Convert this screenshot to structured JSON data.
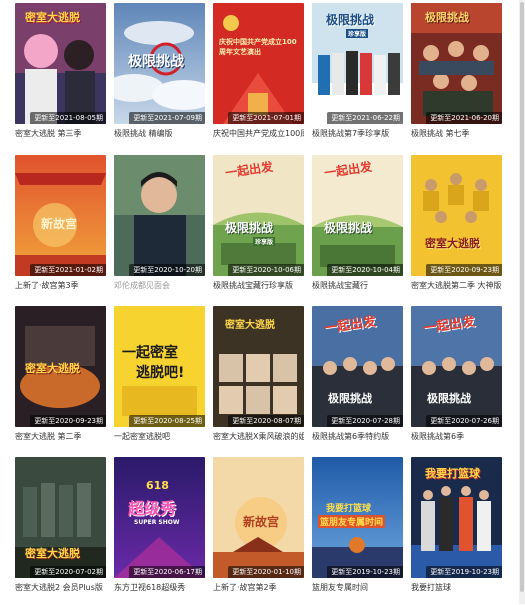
{
  "cards": [
    {
      "title": "密室大逃脱 第三季",
      "badge": "更新至2021-08-05期",
      "logo": "密室大逃脱"
    },
    {
      "title": "极限挑战 精编版",
      "badge": "更新至2021-07-09期",
      "logo": "极限挑战"
    },
    {
      "title": "庆祝中国共产党成立100周",
      "badge": "更新至2021-07-01期",
      "poster_text": "庆祝中国共产党成立100周年文艺演出"
    },
    {
      "title": "极限挑战第7季珍享版",
      "badge": "更新至2021-06-22期",
      "logo": "极限挑战",
      "sub": "珍享版"
    },
    {
      "title": "极限挑战 第七季",
      "badge": "更新至2021-06-20期",
      "logo": "极限挑战"
    },
    {
      "title": "上新了·故宫第3季",
      "badge": "更新至2021-01-02期",
      "logo": "新故宫"
    },
    {
      "title": "邓伦成都见面会",
      "badge": "更新至2020-10-20期",
      "muted": true
    },
    {
      "title": "极限挑战宝藏行珍享版",
      "badge": "更新至2020-10-06期",
      "logo": "极限挑战",
      "logo2": "一起出发",
      "sub": "珍享版"
    },
    {
      "title": "极限挑战宝藏行",
      "badge": "更新至2020-10-04期",
      "logo": "极限挑战",
      "logo2": "一起出发"
    },
    {
      "title": "密室大逃脱第二季 大神版",
      "badge": "更新至2020-09-23期",
      "logo": "密室大逃脱"
    },
    {
      "title": "密室大逃脱 第二季",
      "badge": "更新至2020-09-23期",
      "logo": "密室大逃脱"
    },
    {
      "title": "一起密室逃脱吧",
      "badge": "更新至2020-08-25期",
      "poster_text": "一起密室",
      "poster_text2": "逃脱吧!"
    },
    {
      "title": "密室大逃脱X乘风破浪的姐",
      "badge": "更新至2020-08-07期",
      "logo": "密室大逃脱"
    },
    {
      "title": "极限挑战第6季特约版",
      "badge": "更新至2020-07-28期",
      "logo": "极限挑战",
      "logo2": "一起出发"
    },
    {
      "title": "极限挑战第6季",
      "badge": "更新至2020-07-26期",
      "logo": "极限挑战",
      "logo2": "一起出发"
    },
    {
      "title": "密室大逃脱2 会员Plus版",
      "badge": "更新至2020-07-02期",
      "logo": "密室大逃脱"
    },
    {
      "title": "东方卫视618超级秀",
      "badge": "更新至2020-06-17期",
      "poster_text": "618",
      "poster_text2": "超级秀",
      "sub": "SUPER SHOW"
    },
    {
      "title": "上新了·故宫第2季",
      "badge": "更新至2020-01-10期",
      "logo": "新故宫"
    },
    {
      "title": "篮朋友专属时间",
      "badge": "更新至2019-10-23期",
      "poster_text": "我要打篮球",
      "poster_text2": "篮朋友专属时间"
    },
    {
      "title": "我要打篮球",
      "badge": "更新至2019-10-23期",
      "logo": "我要打篮球"
    }
  ],
  "colors": {
    "title": "#333333",
    "muted": "#999999",
    "badge_bg": "rgba(0,0,0,0.55)"
  }
}
